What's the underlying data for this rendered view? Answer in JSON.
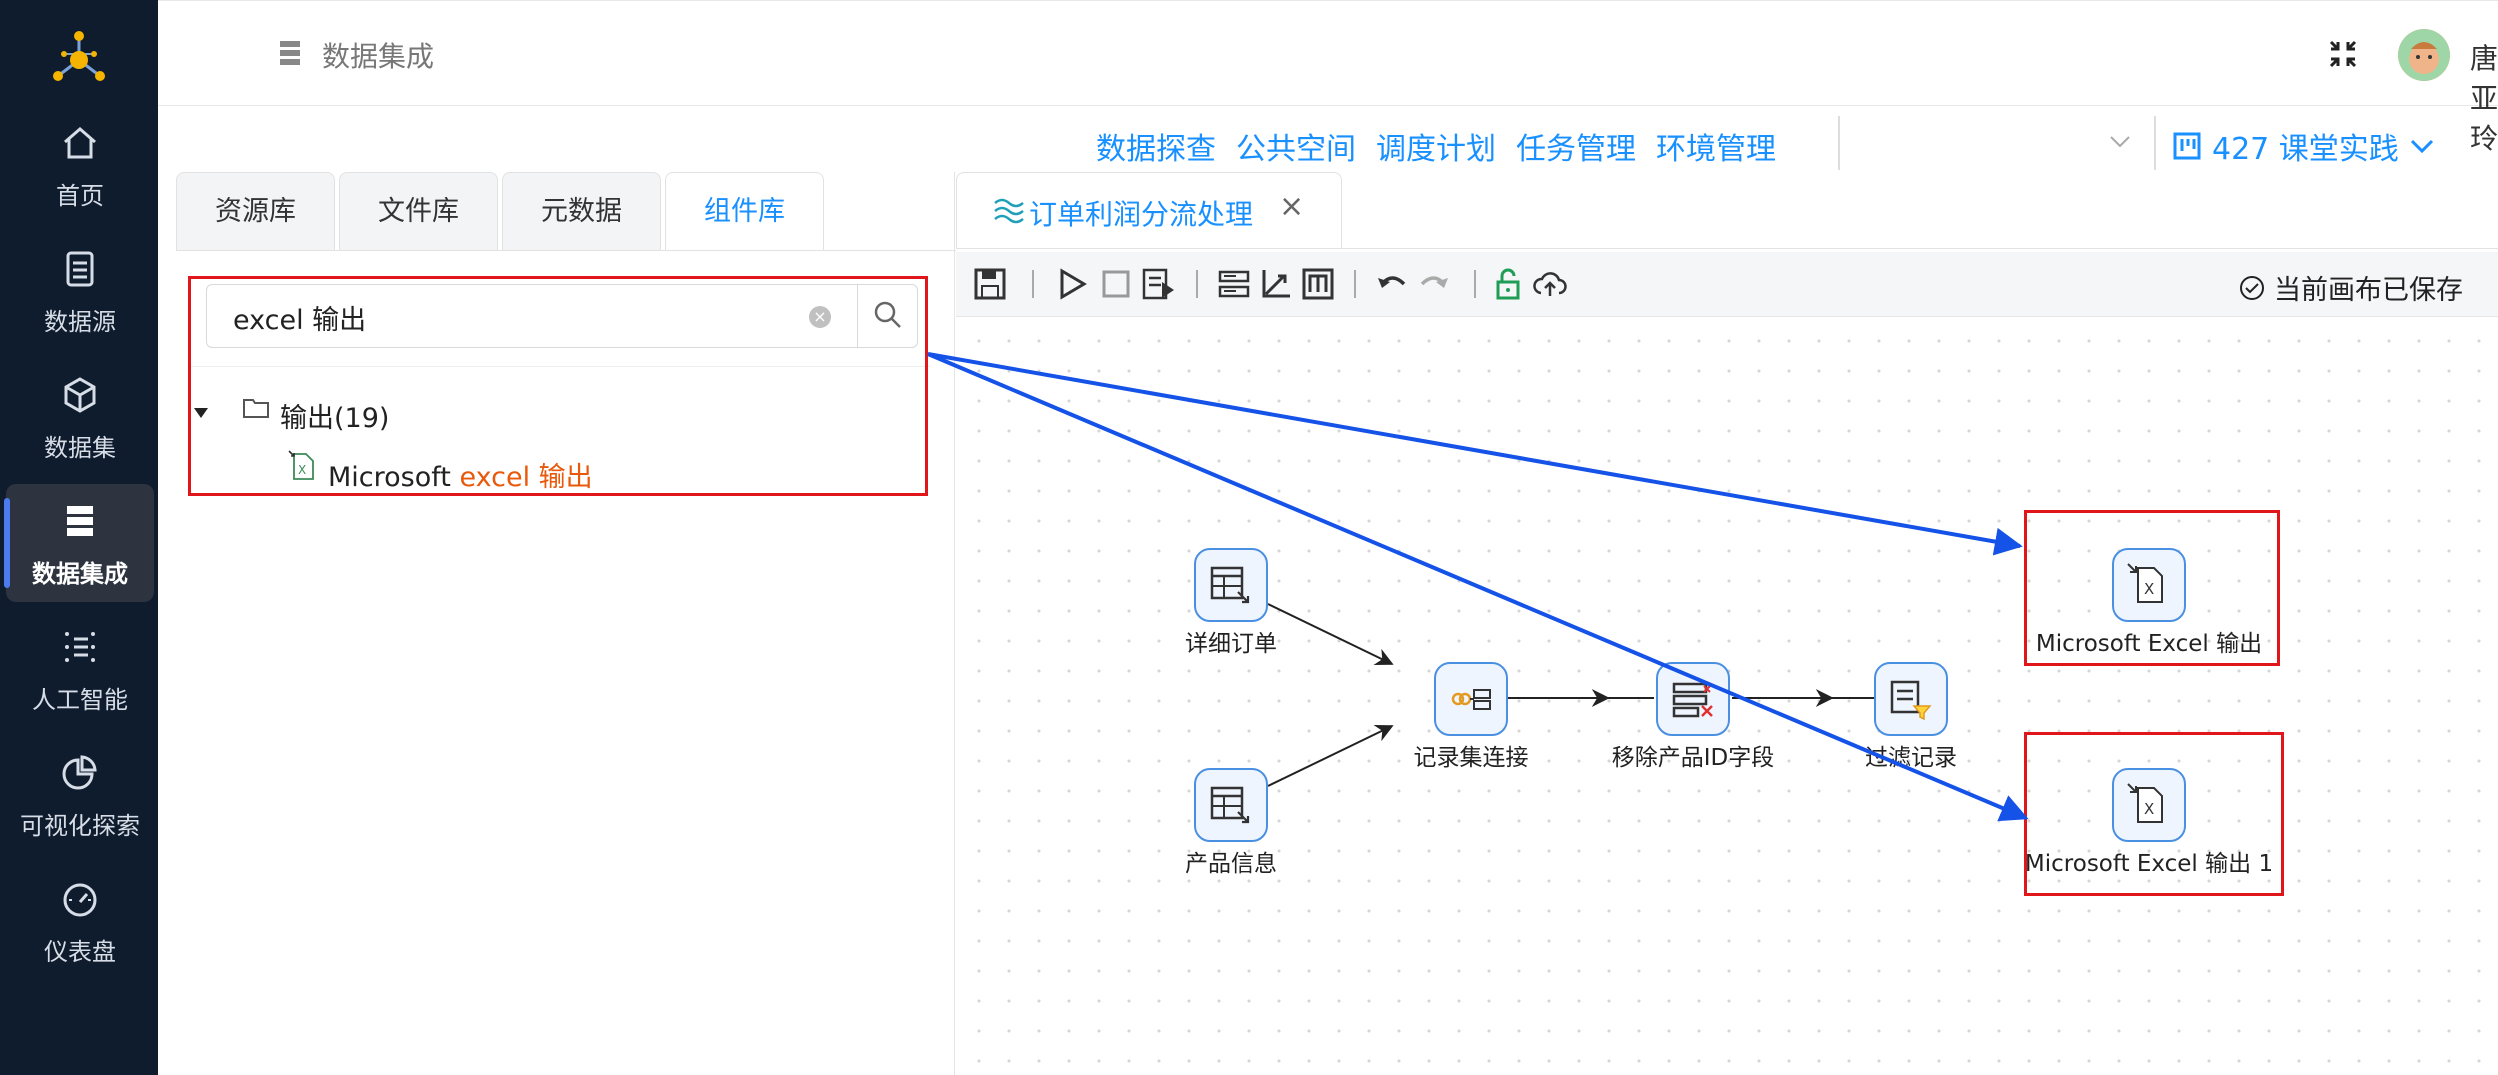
{
  "sidebar": {
    "items": [
      {
        "label": "首页",
        "icon": "home-icon"
      },
      {
        "label": "数据源",
        "icon": "database-icon"
      },
      {
        "label": "数据集",
        "icon": "cube-icon"
      },
      {
        "label": "数据集成",
        "icon": "server-stack-icon",
        "active": true
      },
      {
        "label": "人工智能",
        "icon": "ai-list-icon"
      },
      {
        "label": "可视化探索",
        "icon": "pie-chart-icon"
      },
      {
        "label": "仪表盘",
        "icon": "gauge-icon"
      }
    ]
  },
  "header": {
    "title": "数据集成",
    "user_name": "唐亚玲"
  },
  "nav": {
    "links": [
      "数据探查",
      "公共空间",
      "调度计划",
      "任务管理",
      "环境管理"
    ],
    "project": "427 课堂实践"
  },
  "left_panel": {
    "tabs": [
      "资源库",
      "文件库",
      "元数据",
      "组件库"
    ],
    "active_tab": "组件库",
    "search_value": "excel 输出",
    "tree": {
      "folder": "输出(19)",
      "leaf_prefix": "Microsoft ",
      "leaf_highlight": "excel 输出"
    }
  },
  "canvas_tab": {
    "label": "订单利润分流处理"
  },
  "toolbar": {
    "saved_status": "当前画布已保存"
  },
  "flow": {
    "nodes": [
      {
        "label": "详细订单",
        "icon": "table-input-icon"
      },
      {
        "label": "产品信息",
        "icon": "table-input-icon"
      },
      {
        "label": "记录集连接",
        "icon": "join-icon"
      },
      {
        "label": "移除产品ID字段",
        "icon": "remove-field-icon"
      },
      {
        "label": "过滤记录",
        "icon": "filter-icon"
      },
      {
        "label": "Microsoft Excel 输出",
        "icon": "excel-output-icon"
      },
      {
        "label": "Microsoft Excel 输出 1",
        "icon": "excel-output-icon"
      }
    ]
  },
  "colors": {
    "sidebar_bg": "#0f1c2e",
    "accent": "#1890ff",
    "highlight": "#e8590c",
    "annotation_red": "#e0161b",
    "annotation_arrow": "#1552e8"
  }
}
